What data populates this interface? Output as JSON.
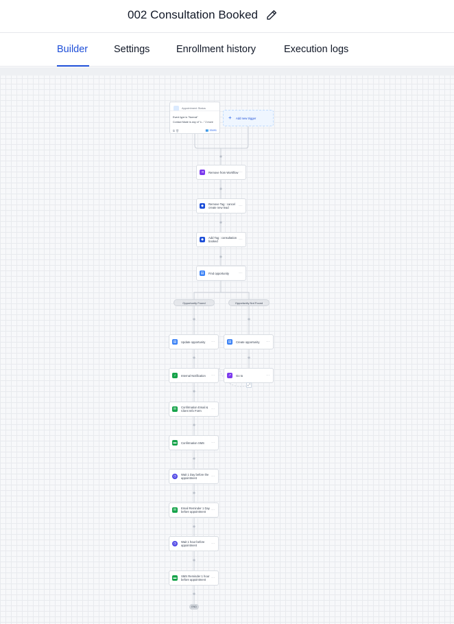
{
  "workflow": {
    "title": "002 Consultation Booked"
  },
  "tabs": [
    {
      "label": "Builder",
      "active": true
    },
    {
      "label": "Settings",
      "active": false
    },
    {
      "label": "Enrollment history",
      "active": false
    },
    {
      "label": "Execution logs",
      "active": false
    }
  ],
  "trigger": {
    "title": "Appointment Status",
    "line1": "Event type is \"Normal\"",
    "line2": "Contact Made is any of \"c...\"",
    "line2_more": "2 more",
    "count": "93491"
  },
  "add_trigger": {
    "label": "Add new trigger"
  },
  "nodes": {
    "remove_from_workflow": "Remove from Workflow",
    "remove_tag": "Remove Tag : cancel create new lead",
    "add_tag": "Add Tag : consultation booked",
    "find_opportunity": "Find opportunity",
    "update_opportunity": "Update opportunity",
    "create_opportunity": "Create opportunity",
    "internal_notification": "Internal Notification",
    "go_to": "Go to",
    "confirmation_email": "Confirmation Email & Client Info Form",
    "confirmation_sms": "Confirmation SMS",
    "wait_1_day": "Wait 1 Day before the appointment",
    "email_reminder": "Email Reminder 1 Day before appointment",
    "wait_1_hour": "Wait 1 hour before appointment",
    "sms_reminder": "SMS Reminder 1 hour before appointment"
  },
  "branches": {
    "found": "Opportunity Found",
    "not_found": "Opportunity Not Found"
  },
  "end": {
    "label": "END"
  },
  "colors": {
    "accent": "#1d4ed8",
    "icon_blue": "#3b82f6",
    "icon_purple": "#7c3aed",
    "icon_green": "#16a34a",
    "icon_indigo": "#4f46e5"
  }
}
